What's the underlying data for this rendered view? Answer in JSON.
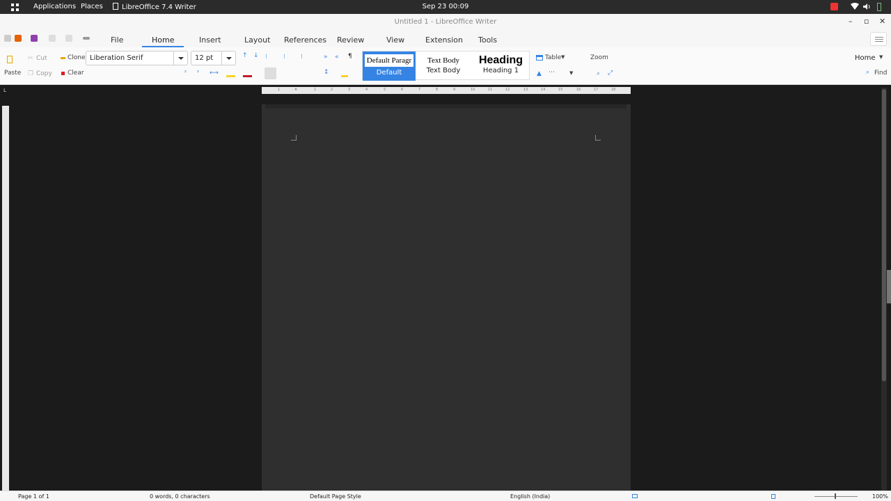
{
  "system_bar": {
    "applications_label": "Applications",
    "places_label": "Places",
    "app_label": "LibreOffice 7.4 Writer",
    "clock": "Sep 23  00:09"
  },
  "window": {
    "title": "Untitled 1 - LibreOffice Writer",
    "minimize": "–",
    "maximize": "▫",
    "close": "✕"
  },
  "tabs": [
    {
      "label": "File"
    },
    {
      "label": "Home"
    },
    {
      "label": "Insert"
    },
    {
      "label": "Layout"
    },
    {
      "label": "References"
    },
    {
      "label": "Review"
    },
    {
      "label": "View"
    },
    {
      "label": "Extension"
    },
    {
      "label": "Tools"
    }
  ],
  "active_tab": "Home",
  "ribbon": {
    "paste": "Paste",
    "cut": "Cut",
    "copy": "Copy",
    "clone": "Clone",
    "clear": "Clear",
    "font_name": "Liberation Serif",
    "font_size": "12 pt",
    "styles": [
      {
        "preview": "Default Paragr",
        "name": "Default"
      },
      {
        "preview": "Text Body",
        "name": "Text Body"
      },
      {
        "preview": "Heading",
        "name": "Heading 1"
      }
    ],
    "table": "Table",
    "zoom": "Zoom",
    "home_combo": "Home",
    "find": "Find"
  },
  "ruler_ticks": [
    "1",
    "1",
    "2",
    "3",
    "4",
    "5",
    "6",
    "7",
    "8",
    "9",
    "10",
    "11",
    "12",
    "13",
    "14",
    "15",
    "16",
    "17",
    "18"
  ],
  "status": {
    "page": "Page 1 of 1",
    "words": "0 words, 0 characters",
    "page_style": "Default Page Style",
    "language": "English (India)",
    "zoom": "100%"
  },
  "colors": {
    "accent": "#3584e4",
    "highlight_yellow": "#f6d32d",
    "font_red": "#c01c28",
    "save_purple": "#9141ac",
    "open_orange": "#e66100"
  }
}
